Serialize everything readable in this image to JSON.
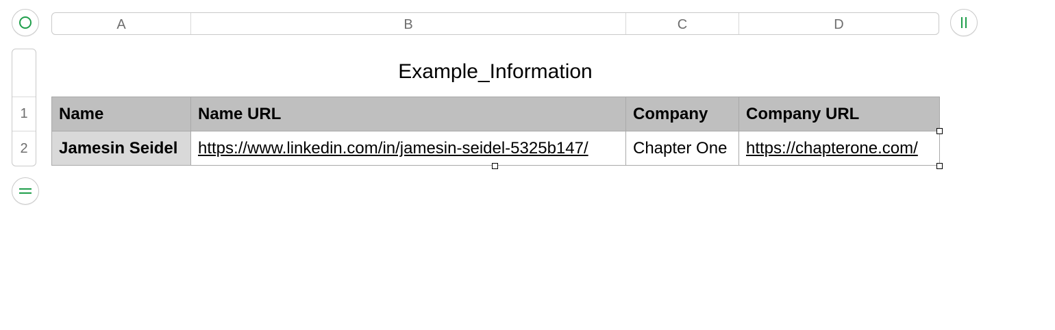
{
  "columns": [
    "A",
    "B",
    "C",
    "D"
  ],
  "rows": [
    "1",
    "2"
  ],
  "table": {
    "title": "Example_Information",
    "headers": [
      "Name",
      "Name URL",
      "Company",
      "Company URL"
    ],
    "data": [
      [
        "Jamesin Seidel",
        "https://www.linkedin.com/in/jamesin-seidel-5325b147/",
        "Chapter One",
        "https://chapterone.com/"
      ]
    ]
  },
  "icons": {
    "top_left": "circle-select-icon",
    "top_right": "add-column-handle-icon",
    "bottom_left": "add-row-handle-icon"
  },
  "colors": {
    "accent": "#1e9e4a",
    "header_fill": "#bfbfbf",
    "row_header_fill": "#d9d9d9"
  }
}
